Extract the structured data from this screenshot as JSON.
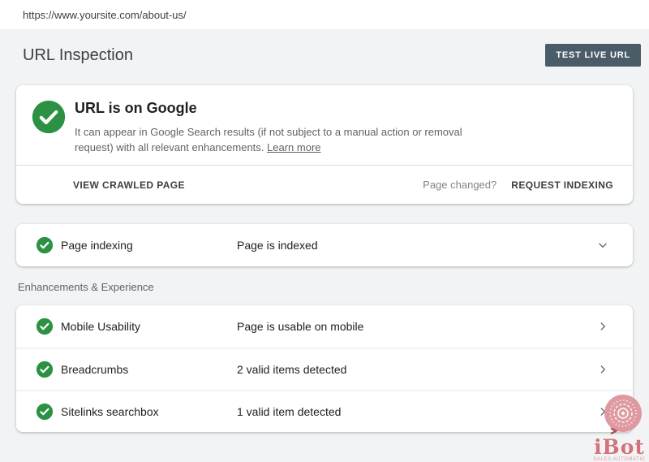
{
  "colors": {
    "success_green": "#2d9144",
    "button_bg": "#4a5c68",
    "page_bg": "#f1f3f4",
    "watermark_pink": "#dd929a"
  },
  "url_bar": {
    "url": "https://www.yoursite.com/about-us/"
  },
  "header": {
    "title": "URL Inspection",
    "test_live_url_button": "TEST LIVE URL"
  },
  "status_card": {
    "title": "URL is on Google",
    "description": "It can appear in Google Search results (if not subject to a manual action or removal request) with all relevant enhancements.",
    "learn_more": "Learn more",
    "view_crawled_page": "VIEW CRAWLED PAGE",
    "page_changed": "Page changed?",
    "request_indexing": "REQUEST INDEXING"
  },
  "page_indexing": {
    "label": "Page indexing",
    "status": "Page is indexed"
  },
  "enhancements_section": {
    "header": "Enhancements & Experience",
    "rows": [
      {
        "label": "Mobile Usability",
        "status": "Page is usable on mobile"
      },
      {
        "label": "Breadcrumbs",
        "status": "2 valid items detected"
      },
      {
        "label": "Sitelinks searchbox",
        "status": "1 valid item detected"
      }
    ]
  },
  "watermark": {
    "name": "iBot",
    "tagline": "SALES AUTOMATIC"
  }
}
